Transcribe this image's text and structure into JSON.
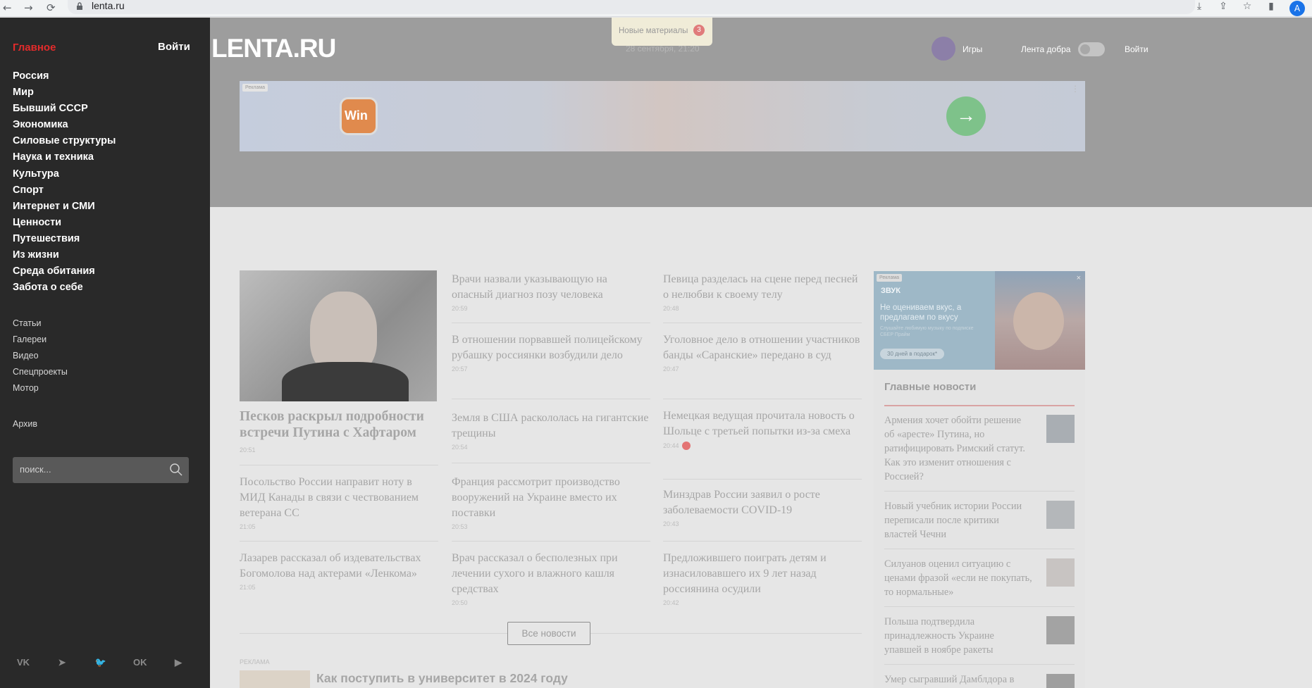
{
  "browser": {
    "url": "lenta.ru",
    "back": "←",
    "forward": "→",
    "reload": "⟳",
    "profile_initial": "A"
  },
  "sidebar": {
    "home_label": "Главное",
    "login_label": "Войти",
    "rubrics": [
      "Россия",
      "Мир",
      "Бывший СССР",
      "Экономика",
      "Силовые структуры",
      "Наука и техника",
      "Культура",
      "Спорт",
      "Интернет и СМИ",
      "Ценности",
      "Путешествия",
      "Из жизни",
      "Среда обитания",
      "Забота о себе"
    ],
    "secondary": [
      "Статьи",
      "Галереи",
      "Видео",
      "Спецпроекты",
      "Мотор"
    ],
    "archive_label": "Архив",
    "search_placeholder": "поиск...",
    "social": [
      "VK",
      "➤",
      "🐦",
      "OK",
      "▶"
    ]
  },
  "header": {
    "logo": "LENTA.RU",
    "date": "28 сентября, 21:20",
    "new_materials_label": "Новые материалы",
    "new_materials_count": "3",
    "games_label": "Игры",
    "kindness_label": "Лента добра",
    "login_label": "Войти"
  },
  "ad_banner": {
    "tag": "Реклама",
    "logo_text": "Win",
    "arrow": "→",
    "dots": "⋮"
  },
  "main_story": {
    "title": "Песков раскрыл подробности встречи Путина с Хафтаром",
    "time": "20:51"
  },
  "news_columns": {
    "col1": [
      {
        "title": "Посольство России направит ноту в МИД Канады в связи с чествованием ветерана СС",
        "time": "21:05"
      },
      {
        "title": "Лазарев рассказал об издевательствах Богомолова над актерами «Ленкома»",
        "time": "21:05"
      }
    ],
    "col2": [
      {
        "title": "Врачи назвали указывающую на опасный диагноз позу человека",
        "time": "20:59"
      },
      {
        "title": "В отношении порвавшей полицейскому рубашку россиянки возбудили дело",
        "time": "20:57"
      },
      {
        "title": "Земля в США раскололась на гигантские трещины",
        "time": "20:54"
      },
      {
        "title": "Франция рассмотрит производство вооружений на Украине вместо их поставки",
        "time": "20:53"
      },
      {
        "title": "Врач рассказал о бесполезных при лечении сухого и влажного кашля средствах",
        "time": "20:50"
      }
    ],
    "col3": [
      {
        "title": "Певица разделась на сцене перед песней о нелюбви к своему телу",
        "time": "20:48"
      },
      {
        "title": "Уголовное дело в отношении участников банды «Саранские» передано в суд",
        "time": "20:47"
      },
      {
        "title": "Немецкая ведущая прочитала новость о Шольце с третьей попытки из-за смеха",
        "time": "20:44"
      },
      {
        "title": "Минздрав России заявил о росте заболеваемости COVID-19",
        "time": "20:43"
      },
      {
        "title": "Предложившего поиграть детям и изнасиловавшего их 9 лет назад россиянина осудили",
        "time": "20:42"
      }
    ]
  },
  "all_news_button": "Все новости",
  "promo": {
    "tag": "РЕКЛАМА",
    "title": "Как поступить в университет в 2024 году"
  },
  "right_ad": {
    "tag": "Реклама",
    "brand": "ЗВУК",
    "slogan": "Не оцениваем вкус, а предлагаем по вкусу",
    "sub": "Слушайте любимую музыку по подписке СБЕР Прайм",
    "cta": "30 дней в подарок*",
    "close": "×"
  },
  "top_news": {
    "title": "Главные новости",
    "items": [
      "Армения хочет обойти решение об «аресте» Путина, но ратифицировать Римский статут. Как это изменит отношения с Россией?",
      "Новый учебник истории России переписали после критики властей Чечни",
      "Силуанов оценил ситуацию с ценами фразой «если не покупать, то нормальные»",
      "Польша подтвердила принадлежность Украине упавшей в ноябре ракеты",
      "Умер сыгравший Дамблдора в"
    ]
  }
}
